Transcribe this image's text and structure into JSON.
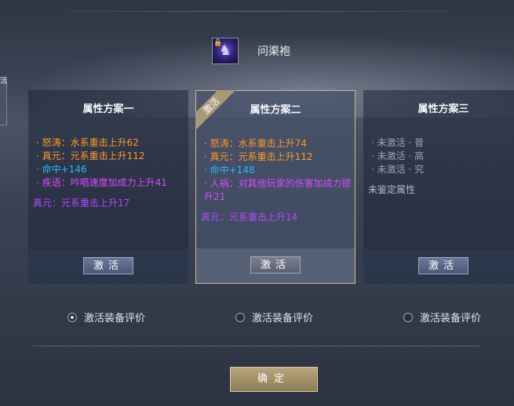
{
  "window": {
    "title": ""
  },
  "item": {
    "name": "问渠袍"
  },
  "left_tab": {
    "label": "活"
  },
  "schemes": [
    {
      "title": "属性方案一",
      "attributes": [
        "· 怒涛：水系重击上升62",
        "· 真元：元系重击上升112",
        "· 命中+146",
        "· 疾语：吟唱速度加成力上升41"
      ],
      "extra": "真元：元系重击上升17",
      "button": "激活"
    },
    {
      "title": "属性方案二",
      "ribbon": "激活",
      "attributes": [
        "· 怒涛：水系重击上升74",
        "· 真元：元系重击上升112",
        "· 命中+148",
        "· 人祸：对其他玩家的伤害加成力提升21"
      ],
      "extra": "真元：元系重击上升14",
      "button": "激活"
    },
    {
      "title": "属性方案三",
      "attributes": [
        "· 未激活 · 普",
        "· 未激活 · 高",
        "· 未激活 · 究"
      ],
      "extra": "未鉴定属性",
      "button": "激活"
    }
  ],
  "radios": [
    {
      "label": "激活装备评价",
      "checked": true
    },
    {
      "label": "激活装备评价",
      "checked": false
    },
    {
      "label": "激活装备评价",
      "checked": false
    }
  ],
  "confirm_label": "确定",
  "colors": {
    "accent_gold": "#cdbd8c",
    "orange": "#ff9a24",
    "blue": "#27b8ff",
    "purple": "#d84bff"
  }
}
